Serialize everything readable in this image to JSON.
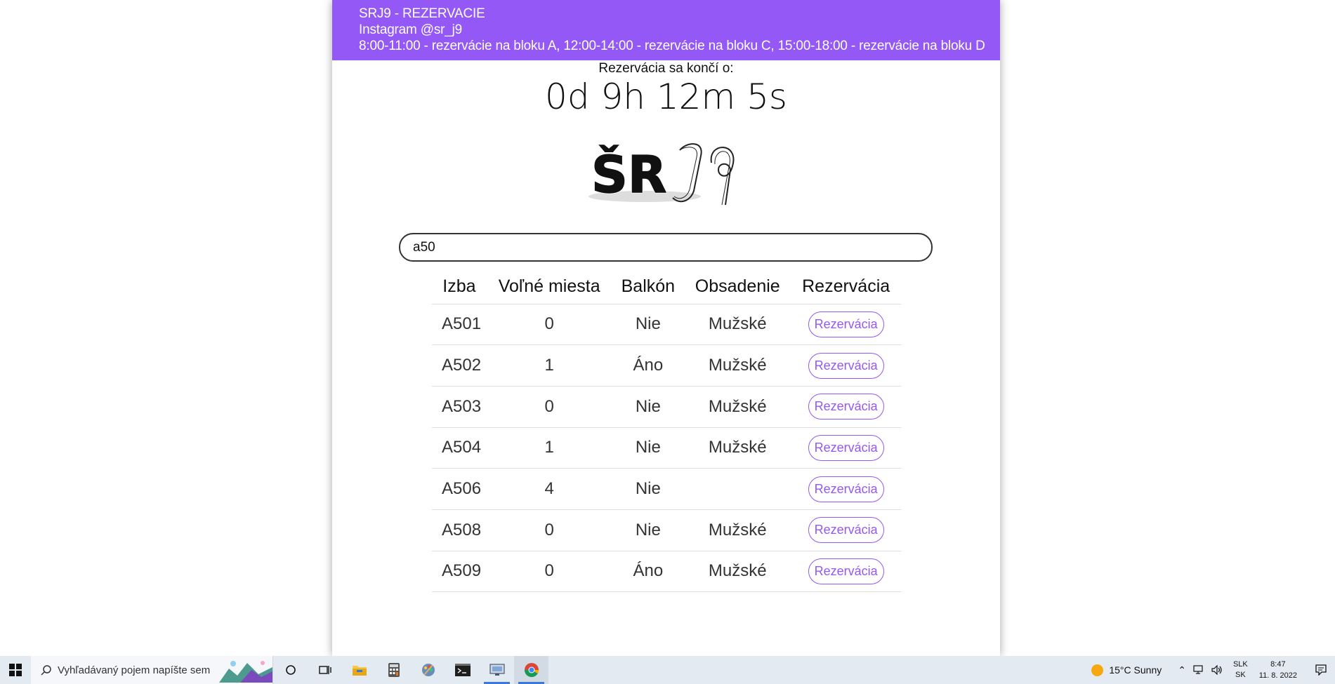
{
  "header": {
    "title": "SRJ9 - REZERVACIE",
    "instagram": "Instagram @sr_j9",
    "schedule": "8:00-11:00 - rezervácie na bloku A, 12:00-14:00 - rezervácie na bloku C, 15:00-18:00 - rezervácie na bloku D"
  },
  "countdown": {
    "label": "Rezervácia sa končí o:",
    "value": "0d 9h 12m 5s"
  },
  "logo": {
    "text": "ŠRJ9"
  },
  "search": {
    "value": "a50"
  },
  "table": {
    "headers": [
      "Izba",
      "Voľné miesta",
      "Balkón",
      "Obsadenie",
      "Rezervácia"
    ],
    "rows": [
      {
        "room": "A501",
        "free": "0",
        "balcony": "Nie",
        "occupancy": "Mužské",
        "button": "Rezervácia"
      },
      {
        "room": "A502",
        "free": "1",
        "balcony": "Áno",
        "occupancy": "Mužské",
        "button": "Rezervácia"
      },
      {
        "room": "A503",
        "free": "0",
        "balcony": "Nie",
        "occupancy": "Mužské",
        "button": "Rezervácia"
      },
      {
        "room": "A504",
        "free": "1",
        "balcony": "Nie",
        "occupancy": "Mužské",
        "button": "Rezervácia"
      },
      {
        "room": "A506",
        "free": "4",
        "balcony": "Nie",
        "occupancy": "",
        "button": "Rezervácia"
      },
      {
        "room": "A508",
        "free": "0",
        "balcony": "Nie",
        "occupancy": "Mužské",
        "button": "Rezervácia"
      },
      {
        "room": "A509",
        "free": "0",
        "balcony": "Áno",
        "occupancy": "Mužské",
        "button": "Rezervácia"
      }
    ]
  },
  "colors": {
    "accent": "#9358f5"
  },
  "taskbar": {
    "search_placeholder": "Vyhľadávaný pojem napíšte sem",
    "weather": "15°C  Sunny",
    "lang_top": "SLK",
    "lang_bottom": "SK",
    "time": "8:47",
    "date": "11. 8. 2022"
  }
}
